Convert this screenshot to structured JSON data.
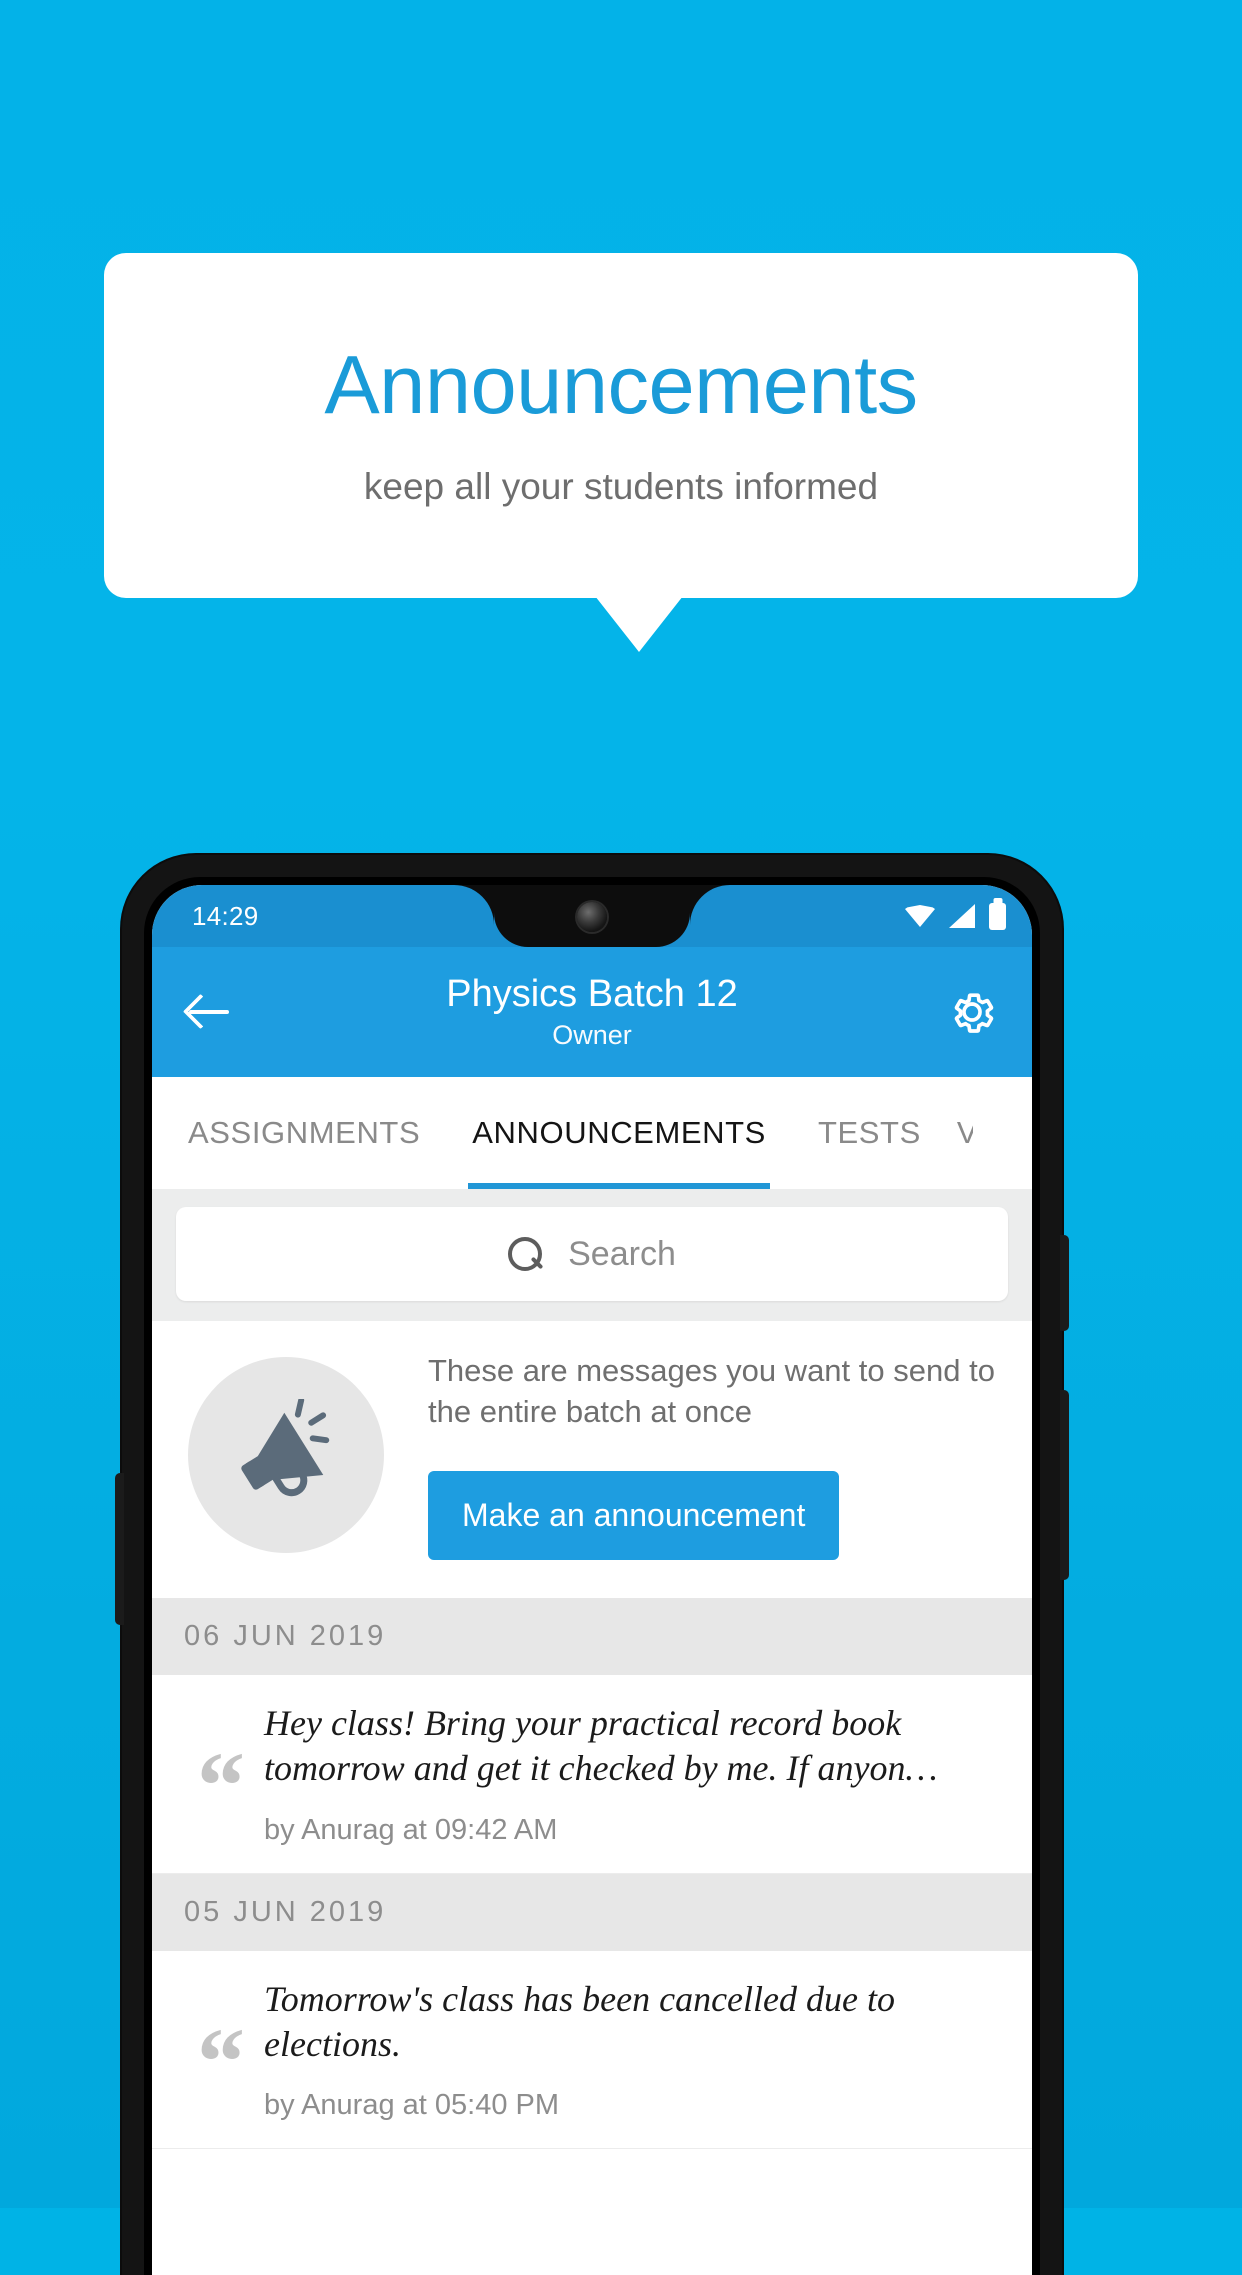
{
  "promo": {
    "title": "Announcements",
    "subtitle": "keep all your students informed",
    "title_color": "#1a9bd8",
    "background_color": "#03b2e8"
  },
  "phone": {
    "statusbar": {
      "time": "14:29",
      "icons": [
        "wifi-icon",
        "signal-icon",
        "battery-icon"
      ]
    },
    "appbar": {
      "back_icon": "back-arrow-icon",
      "title": "Physics Batch 12",
      "subtitle": "Owner",
      "settings_icon": "gear-icon",
      "color": "#1e9de0"
    },
    "tabs": [
      {
        "label": "ASSIGNMENTS",
        "active": false
      },
      {
        "label": "ANNOUNCEMENTS",
        "active": true
      },
      {
        "label": "TESTS",
        "active": false
      },
      {
        "label": "V",
        "active": false
      }
    ],
    "search": {
      "icon": "search-icon",
      "placeholder": "Search",
      "value": ""
    },
    "empty_promo": {
      "icon": "megaphone-icon",
      "text": "These are messages you want to send to the entire batch at once",
      "button_label": "Make an announcement",
      "button_color": "#1e9de0"
    },
    "groups": [
      {
        "date": "06  JUN  2019",
        "items": [
          {
            "quote_icon": "quote-icon",
            "text": "Hey class! Bring your practical record book tomorrow and get it checked by me. If anyon…",
            "meta": "by Anurag at 09:42 AM"
          }
        ]
      },
      {
        "date": "05  JUN  2019",
        "items": [
          {
            "quote_icon": "quote-icon",
            "text": "Tomorrow's class has been cancelled due to elections.",
            "meta": "by Anurag at 05:40 PM"
          }
        ]
      }
    ]
  }
}
